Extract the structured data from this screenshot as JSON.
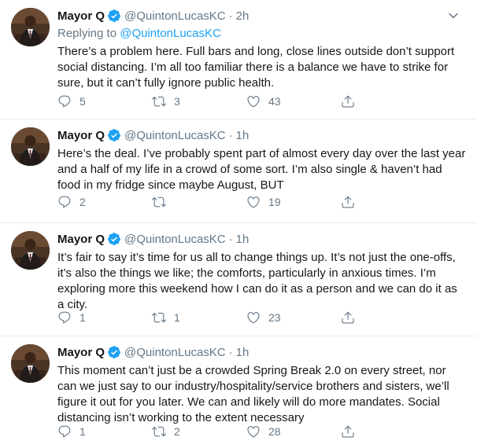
{
  "tweets": [
    {
      "name": "Mayor Q",
      "handle": "@QuintonLucasKC",
      "separator": "·",
      "time": "2h",
      "reply_prefix": "Replying to",
      "reply_to": "@QuintonLucasKC",
      "text": "There’s a problem here. Full bars and long, close lines outside don’t support social distancing. I’m all too familiar there is a balance we have to strike for sure, but it can’t fully ignore public health.",
      "replies": "5",
      "retweets": "3",
      "likes": "43"
    },
    {
      "name": "Mayor Q",
      "handle": "@QuintonLucasKC",
      "separator": "·",
      "time": "1h",
      "text": "Here’s the deal. I’ve probably spent part of almost every day over the last year and a half of my life in a crowd of some sort. I’m also single & haven’t had food in my fridge since maybe August, BUT",
      "replies": "2",
      "retweets": "",
      "likes": "19"
    },
    {
      "name": "Mayor Q",
      "handle": "@QuintonLucasKC",
      "separator": "·",
      "time": "1h",
      "text": "It’s fair to say it’s time for us all to change things up. It’s not just the one-offs, it’s also the things we like; the comforts, particularly in anxious times. I’m exploring more this weekend how I can do it as a person and we can do it as a city.",
      "replies": "1",
      "retweets": "1",
      "likes": "23"
    },
    {
      "name": "Mayor Q",
      "handle": "@QuintonLucasKC",
      "separator": "·",
      "time": "1h",
      "text": "This moment can’t just be a crowded Spring Break 2.0 on every street, nor can we just say to our industry/hospitality/service brothers and sisters, we’ll figure it out for you later. We can and likely will do more mandates. Social distancing isn’t working to the extent necessary",
      "replies": "1",
      "retweets": "2",
      "likes": "28"
    }
  ],
  "colors": {
    "text": "#14171a",
    "secondary": "#657786",
    "link": "#1da1f2",
    "divider": "#e6ecf0"
  },
  "icons": [
    "verified-badge-icon",
    "chevron-down-icon",
    "reply-icon",
    "retweet-icon",
    "like-icon",
    "share-icon"
  ]
}
